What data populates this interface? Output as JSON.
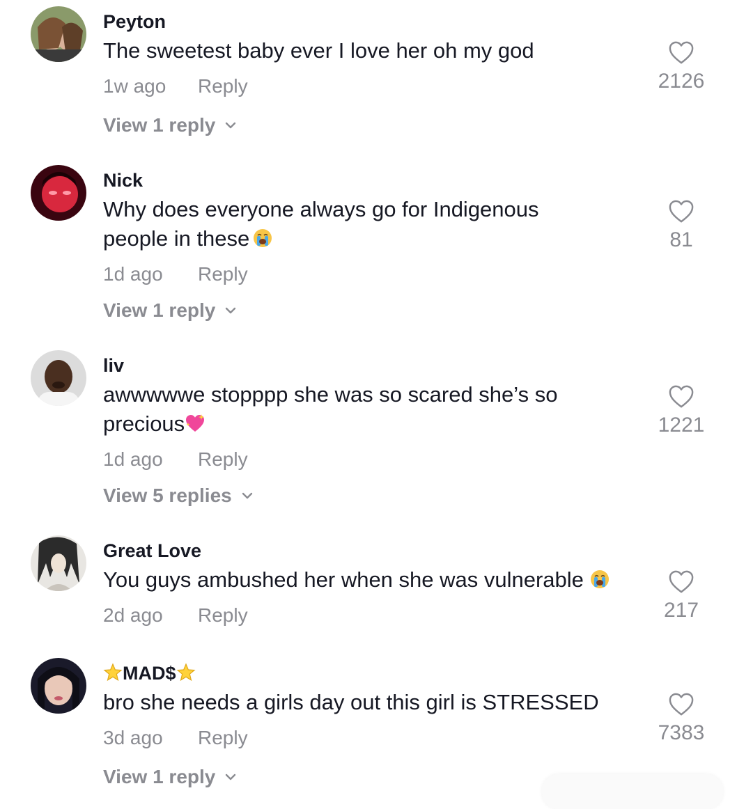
{
  "comments": [
    {
      "username": "Peyton",
      "text": "The sweetest baby ever I love her oh my god",
      "time": "1w ago",
      "reply_label": "Reply",
      "likes": "2126",
      "view_replies": "View 1 reply",
      "avatar": "avatar-photo-two-girls"
    },
    {
      "username": "Nick",
      "text": "Why does everyone always go for Indigenous people in these",
      "emoji": "loudly-crying-face-emoji",
      "time": "1d ago",
      "reply_label": "Reply",
      "likes": "81",
      "view_replies": "View 1 reply",
      "avatar": "avatar-photo-red-light"
    },
    {
      "username": "liv",
      "text": "awwwwwe stopppp she was so scared she’s so precious",
      "emoji": "sparkling-heart-emoji",
      "time": "1d ago",
      "reply_label": "Reply",
      "likes": "1221",
      "view_replies": "View 5 replies",
      "avatar": "avatar-photo-man"
    },
    {
      "username": "Great Love",
      "text": "You guys ambushed her when she was vulnerable",
      "emoji": "loudly-crying-face-emoji",
      "time": "2d ago",
      "reply_label": "Reply",
      "likes": "217",
      "avatar": "avatar-anime-drawing"
    },
    {
      "username": "MAD$",
      "username_icons": "star-emoji",
      "text": "bro she needs a girls day out this girl is STRESSED",
      "time": "3d ago",
      "reply_label": "Reply",
      "likes": "7383",
      "view_replies": "View 1 reply",
      "avatar": "avatar-photo-woman"
    }
  ],
  "colors": {
    "primary_text": "#161823",
    "secondary_text": "#8a8b91",
    "background": "#ffffff"
  },
  "icons": {
    "like": "heart-outline-icon",
    "expand": "chevron-down-icon"
  }
}
